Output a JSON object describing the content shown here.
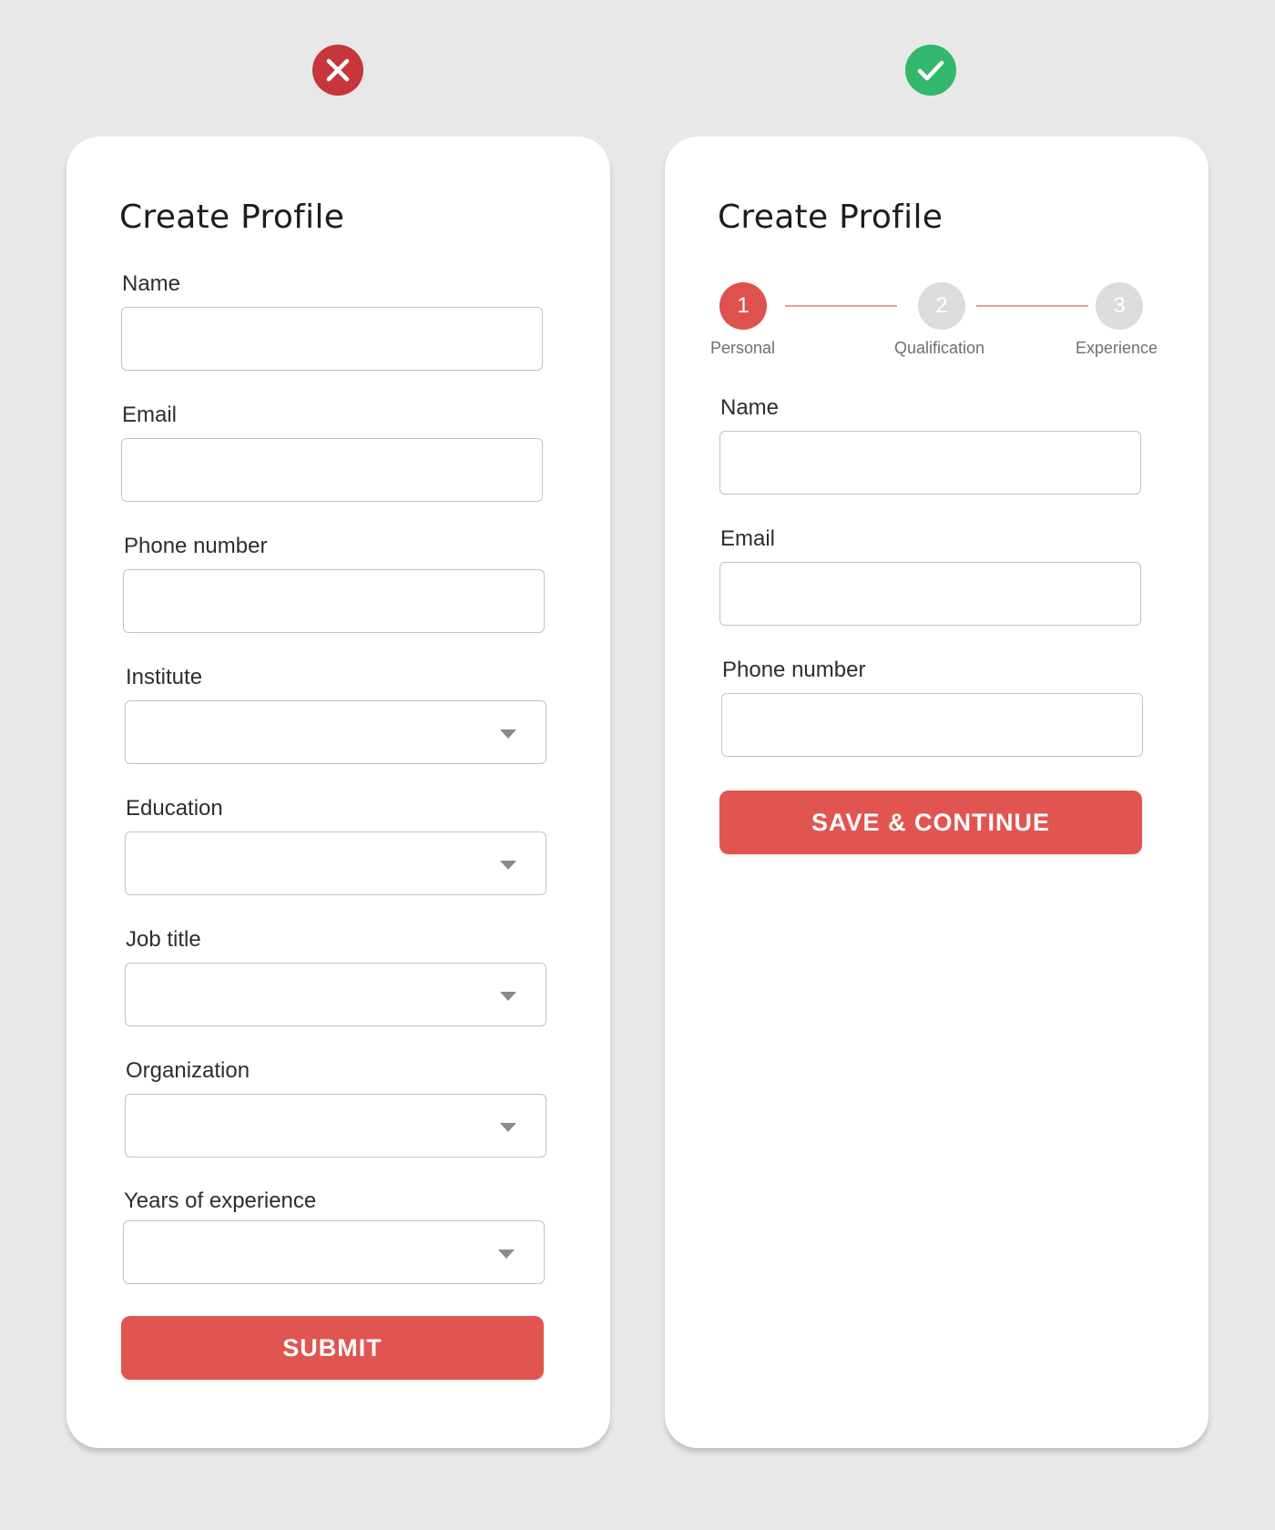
{
  "colors": {
    "page_background": "#e8e8e8",
    "card_background": "#ffffff",
    "accent_red": "#e05550",
    "bad_badge": "#c6363a",
    "good_badge": "#33b86b",
    "step_inactive": "#dcdcdc",
    "input_border": "#c3c3c3"
  },
  "bad_example": {
    "badge_icon": "x-close-icon",
    "title": "Create Profile",
    "fields": [
      {
        "label": "Name",
        "type": "text",
        "value": ""
      },
      {
        "label": "Email",
        "type": "text",
        "value": ""
      },
      {
        "label": "Phone number",
        "type": "text",
        "value": ""
      },
      {
        "label": "Institute",
        "type": "select",
        "value": ""
      },
      {
        "label": "Education",
        "type": "select",
        "value": ""
      },
      {
        "label": "Job title",
        "type": "select",
        "value": ""
      },
      {
        "label": "Organization",
        "type": "select",
        "value": ""
      },
      {
        "label": "Years of experience",
        "type": "select",
        "value": ""
      }
    ],
    "submit_label": "SUBMIT"
  },
  "good_example": {
    "badge_icon": "checkmark-icon",
    "title": "Create Profile",
    "stepper": [
      {
        "number": "1",
        "label": "Personal",
        "state": "active"
      },
      {
        "number": "2",
        "label": "Qualification",
        "state": "inactive"
      },
      {
        "number": "3",
        "label": "Experience",
        "state": "inactive"
      }
    ],
    "fields": [
      {
        "label": "Name",
        "type": "text",
        "value": ""
      },
      {
        "label": "Email",
        "type": "text",
        "value": ""
      },
      {
        "label": "Phone number",
        "type": "text",
        "value": ""
      }
    ],
    "submit_label": "SAVE & CONTINUE"
  }
}
